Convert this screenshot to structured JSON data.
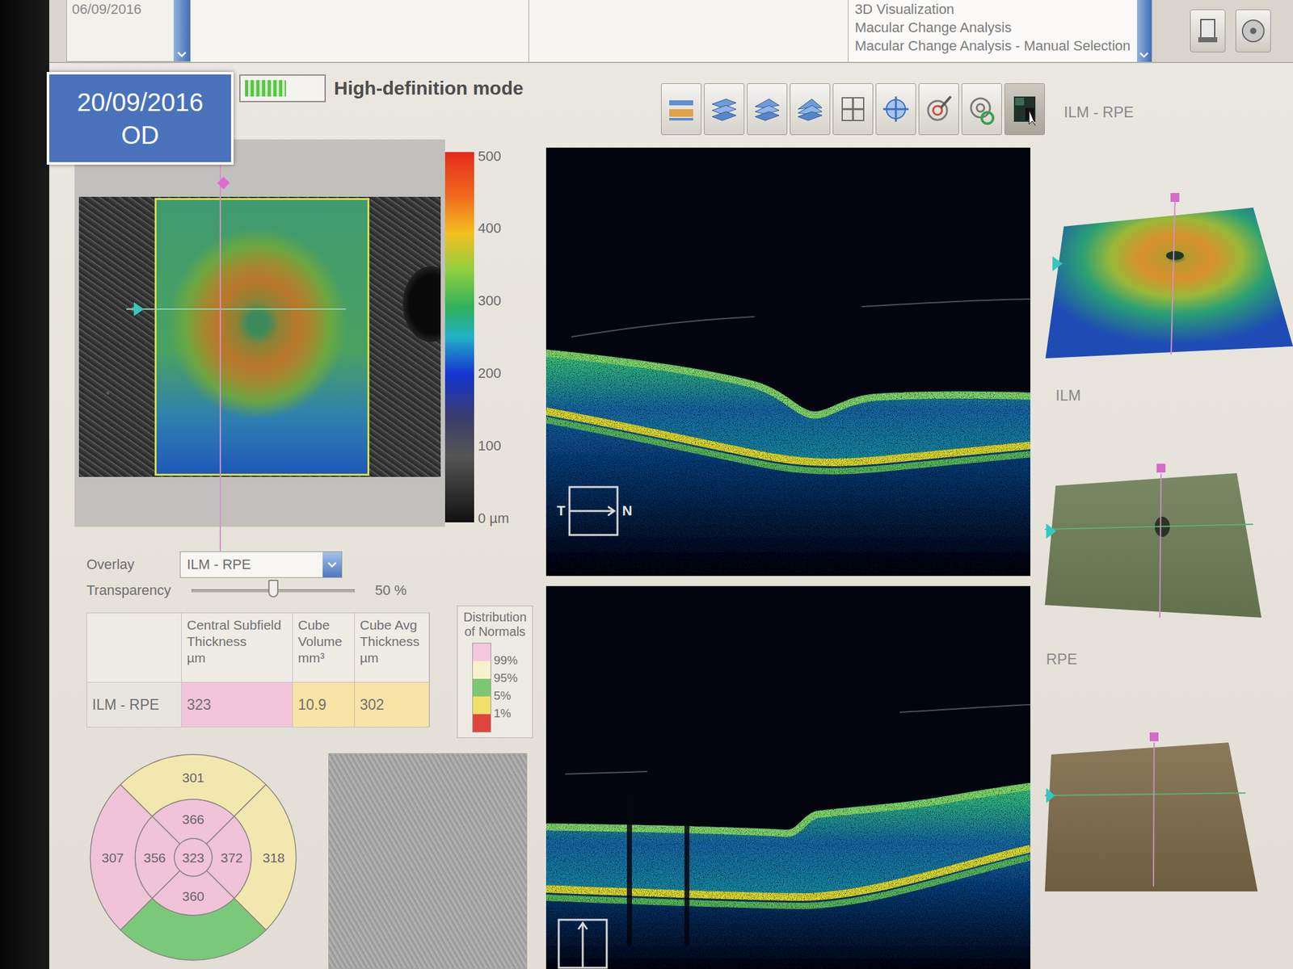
{
  "top_bar": {
    "date": "06/09/2016",
    "views": [
      {
        "label": "3D Visualization",
        "selected": false
      },
      {
        "label": "Macular Change Analysis",
        "selected": false
      },
      {
        "label": "Macular Change Analysis - Manual Selection",
        "selected": false
      }
    ]
  },
  "badge": {
    "date": "20/09/2016",
    "eye": "OD"
  },
  "hd_mode": {
    "label": "High-definition mode",
    "level": 0.55
  },
  "toolbar": [
    {
      "kind": "measure",
      "selected": false
    },
    {
      "kind": "layers-a",
      "selected": false
    },
    {
      "kind": "layers-b",
      "selected": false
    },
    {
      "kind": "layers-c",
      "selected": false
    },
    {
      "kind": "grid",
      "selected": false
    },
    {
      "kind": "crosshair",
      "selected": false
    },
    {
      "kind": "target-edit",
      "selected": false
    },
    {
      "kind": "target-rotate",
      "selected": false
    },
    {
      "kind": "scan-view",
      "selected": true
    }
  ],
  "color_scale": {
    "ticks": [
      "500",
      "400",
      "300",
      "200",
      "100",
      "0 µm"
    ]
  },
  "overlay": {
    "label": "Overlay",
    "value": "ILM - RPE"
  },
  "transparency": {
    "label": "Transparency",
    "level": 0.5,
    "reading": "50 %"
  },
  "table": {
    "columns": [
      {
        "lines": []
      },
      {
        "lines": [
          "Central Subfield",
          "Thickness",
          "µm"
        ]
      },
      {
        "lines": [
          "Cube",
          "Volume",
          "mm³"
        ]
      },
      {
        "lines": [
          "Cube Avg",
          "Thickness",
          "µm"
        ]
      }
    ],
    "rows": [
      {
        "label": "ILM - RPE",
        "cells": [
          {
            "value": "323",
            "color": "#f2c4d9"
          },
          {
            "value": "10.9",
            "color": "#f7e4a6"
          },
          {
            "value": "302",
            "color": "#f7e4a6"
          }
        ]
      }
    ]
  },
  "distribution": {
    "title": "Distribution of Normals",
    "labels": [
      "99%",
      "95%",
      "5%",
      "1%"
    ],
    "swatches": [
      {
        "color": "#f3c8de"
      },
      {
        "color": "#f8f2cc"
      },
      {
        "color": "#7cc872"
      },
      {
        "color": "#f2df6a"
      },
      {
        "color": "#e0463e"
      }
    ]
  },
  "etdrs": [
    {
      "position": "center",
      "value": "323",
      "color": "#f0c3d8"
    },
    {
      "position": "inner-top",
      "value": "366",
      "color": "#f0c3d8"
    },
    {
      "position": "inner-right",
      "value": "372",
      "color": "#f0c3d8"
    },
    {
      "position": "inner-bottom",
      "value": "360",
      "color": "#f0c3d8"
    },
    {
      "position": "inner-left",
      "value": "356",
      "color": "#f0c3d8"
    },
    {
      "position": "outer-top",
      "value": "301",
      "color": "#f3e7b0"
    },
    {
      "position": "outer-right",
      "value": "318",
      "color": "#f3e7b0"
    },
    {
      "position": "outer-bottom",
      "value": "",
      "color": "#7ac87a"
    },
    {
      "position": "outer-left",
      "value": "307",
      "color": "#f0c3d8"
    }
  ],
  "bscans": [
    {
      "kind": "horizontal",
      "labels": [
        "T",
        "N"
      ]
    },
    {
      "kind": "vertical",
      "labels": []
    }
  ],
  "views_3d": [
    {
      "kind": "thickness",
      "label": "ILM - RPE"
    },
    {
      "kind": "ilm",
      "label": "ILM"
    },
    {
      "kind": "rpe",
      "label": "RPE"
    }
  ]
}
